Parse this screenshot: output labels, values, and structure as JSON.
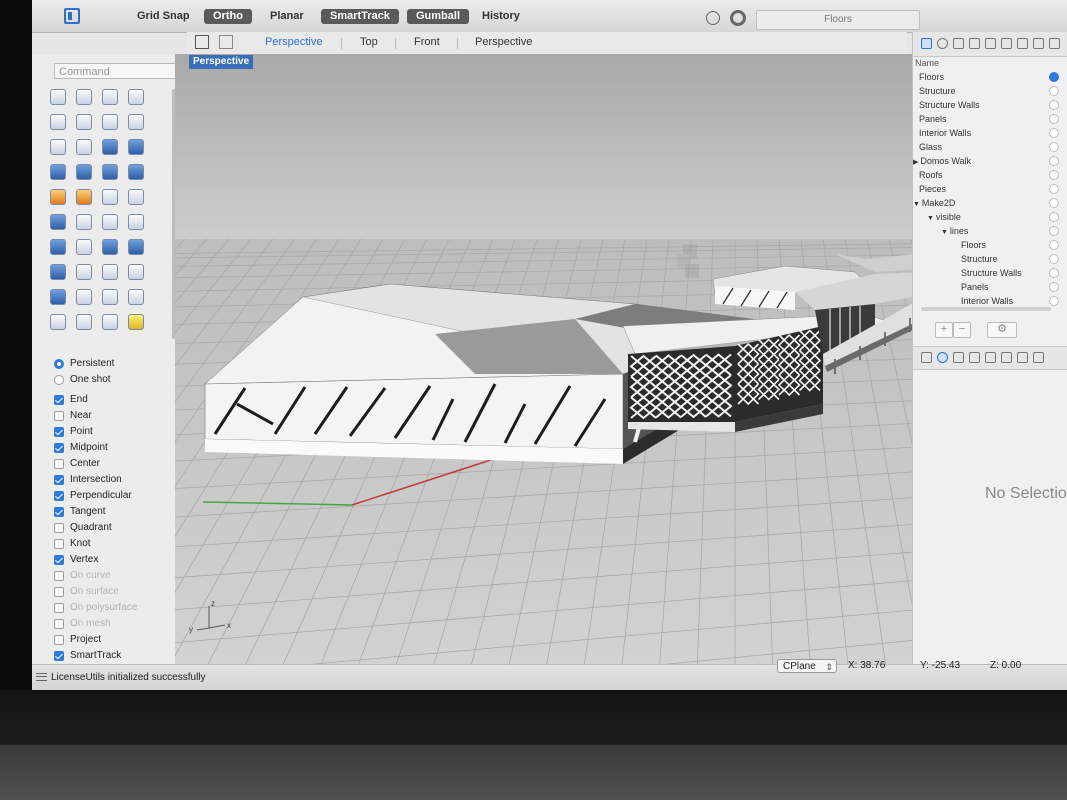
{
  "toolbar": {
    "items": [
      {
        "label": "Grid Snap",
        "on": false
      },
      {
        "label": "Ortho",
        "on": true
      },
      {
        "label": "Planar",
        "on": false
      },
      {
        "label": "SmartTrack",
        "on": true
      },
      {
        "label": "Gumball",
        "on": true
      },
      {
        "label": "History",
        "on": false
      }
    ],
    "current_layer": "Floors"
  },
  "viewport_tabs": [
    "Perspective",
    "Top",
    "Front",
    "Perspective"
  ],
  "viewport_label": "Perspective",
  "command_placeholder": "Command",
  "osnap": {
    "modes": [
      {
        "label": "Persistent",
        "selected": true
      },
      {
        "label": "One shot",
        "selected": false
      }
    ],
    "items": [
      {
        "label": "End",
        "checked": true,
        "enabled": true
      },
      {
        "label": "Near",
        "checked": false,
        "enabled": true
      },
      {
        "label": "Point",
        "checked": true,
        "enabled": true
      },
      {
        "label": "Midpoint",
        "checked": true,
        "enabled": true
      },
      {
        "label": "Center",
        "checked": false,
        "enabled": true
      },
      {
        "label": "Intersection",
        "checked": true,
        "enabled": true
      },
      {
        "label": "Perpendicular",
        "checked": true,
        "enabled": true
      },
      {
        "label": "Tangent",
        "checked": true,
        "enabled": true
      },
      {
        "label": "Quadrant",
        "checked": false,
        "enabled": true
      },
      {
        "label": "Knot",
        "checked": false,
        "enabled": true
      },
      {
        "label": "Vertex",
        "checked": true,
        "enabled": true
      },
      {
        "label": "On curve",
        "checked": false,
        "enabled": false
      },
      {
        "label": "On surface",
        "checked": false,
        "enabled": false
      },
      {
        "label": "On polysurface",
        "checked": false,
        "enabled": false
      },
      {
        "label": "On mesh",
        "checked": false,
        "enabled": false
      },
      {
        "label": "Project",
        "checked": false,
        "enabled": true
      },
      {
        "label": "SmartTrack",
        "checked": true,
        "enabled": true
      }
    ]
  },
  "layers": {
    "header": "Name",
    "items": [
      {
        "name": "Floors",
        "indent": 0,
        "arrow": "",
        "current": true
      },
      {
        "name": "Structure",
        "indent": 0,
        "arrow": "",
        "current": false
      },
      {
        "name": "Structure Walls",
        "indent": 0,
        "arrow": "",
        "current": false
      },
      {
        "name": "Panels",
        "indent": 0,
        "arrow": "",
        "current": false
      },
      {
        "name": "Interior Walls",
        "indent": 0,
        "arrow": "",
        "current": false
      },
      {
        "name": "Glass",
        "indent": 0,
        "arrow": "",
        "current": false
      },
      {
        "name": "Domos Walk",
        "indent": 0,
        "arrow": "▶",
        "current": false
      },
      {
        "name": "Roofs",
        "indent": 0,
        "arrow": "",
        "current": false
      },
      {
        "name": "Pieces",
        "indent": 0,
        "arrow": "",
        "current": false
      },
      {
        "name": "Make2D",
        "indent": 0,
        "arrow": "▼",
        "current": false
      },
      {
        "name": "visible",
        "indent": 1,
        "arrow": "▼",
        "current": false
      },
      {
        "name": "lines",
        "indent": 2,
        "arrow": "▼",
        "current": false
      },
      {
        "name": "Floors",
        "indent": 3,
        "arrow": "",
        "current": false
      },
      {
        "name": "Structure",
        "indent": 3,
        "arrow": "",
        "current": false
      },
      {
        "name": "Structure Walls",
        "indent": 3,
        "arrow": "",
        "current": false
      },
      {
        "name": "Panels",
        "indent": 3,
        "arrow": "",
        "current": false
      },
      {
        "name": "Interior Walls",
        "indent": 3,
        "arrow": "",
        "current": false
      }
    ]
  },
  "properties": {
    "empty_text": "No Selection"
  },
  "statusbar": {
    "message": "LicenseUtils initialized successfully",
    "cplane": "CPlane",
    "x": "X: 38.76",
    "y": "Y: -25.43",
    "z": "Z: 0.00"
  },
  "axis_labels": {
    "x": "x",
    "y": "y",
    "z": "z"
  }
}
